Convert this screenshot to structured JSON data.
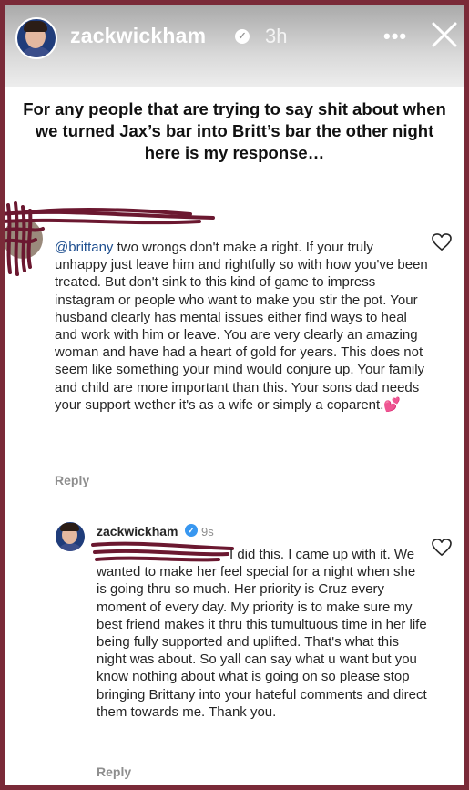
{
  "story": {
    "username": "zackwickham",
    "time": "3h",
    "more_label": "•••",
    "headline": "For any people that are trying to say shit about when we turned Jax’s bar into Britt’s bar the other night here is my response…"
  },
  "comment": {
    "mention": "@brittany",
    "text": " two wrongs don't make a right. If your truly unhappy just leave him and rightfully so with how you've been treated. But don't sink to this kind of game to impress instagram or people who want to make you stir the pot. Your husband clearly has mental issues either find ways to heal and work with him or leave. You are very clearly an amazing woman and have had a heart of gold for years. This does not seem like something your mind would conjure up. Your family and child are more important than this. Your sons dad needs your support wether it's as a wife or simply a coparent.💕",
    "reply_label": "Reply"
  },
  "reply": {
    "username": "zackwickham",
    "time": "9s",
    "text": "I did this. I came up with it. We wanted to make her feel special for a night when she is going thru so much. Her priority is Cruz every moment of every day. My priority is to make sure my best friend makes it thru this tumultuous time in her life being fully supported and uplifted. That's what this night was about. So yall can say what u want but you know nothing about what is going on so please stop bringing Brittany into your hateful comments and direct them towards me. Thank you.",
    "reply_label": "Reply"
  },
  "colors": {
    "border": "#7a2a38",
    "scribble": "#6b1830",
    "verified_blue": "#3897f0",
    "mention_blue": "#1d4e8f"
  }
}
